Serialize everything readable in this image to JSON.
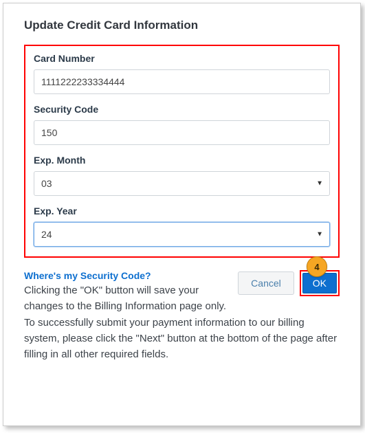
{
  "dialog": {
    "title": "Update Credit Card Information"
  },
  "form": {
    "card_number": {
      "label": "Card Number",
      "value": "1111222233334444"
    },
    "security_code": {
      "label": "Security Code",
      "value": "150"
    },
    "exp_month": {
      "label": "Exp. Month",
      "value": "03"
    },
    "exp_year": {
      "label": "Exp. Year",
      "value": "24"
    }
  },
  "annotation": {
    "step_number": "4"
  },
  "footer": {
    "cancel_label": "Cancel",
    "ok_label": "OK",
    "help_heading": "Where's my Security Code?",
    "help_text": "Clicking the \"OK\" button will save your changes to the Billing Information page only. To successfully submit your payment information to our billing system, please click the \"Next\" button at the bottom of the page after filling in all other required fields."
  }
}
